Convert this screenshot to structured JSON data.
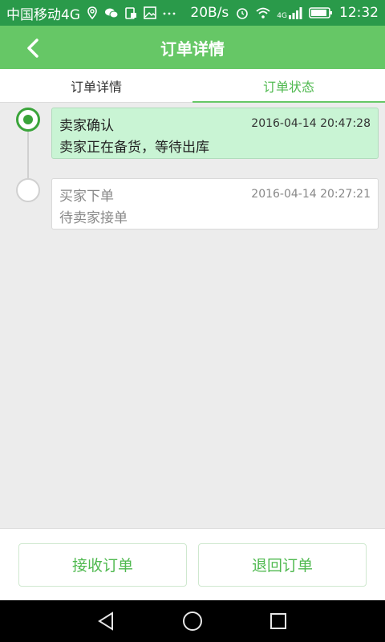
{
  "status_bar": {
    "carrier": "中国移动4G",
    "speed": "20B/s",
    "network": "4G",
    "time": "12:32"
  },
  "app_bar": {
    "title": "订单详情"
  },
  "tabs": [
    {
      "label": "订单详情",
      "active": false
    },
    {
      "label": "订单状态",
      "active": true
    }
  ],
  "timeline": [
    {
      "title": "卖家确认",
      "time": "2016-04-14 20:47:28",
      "desc": "卖家正在备货，等待出库",
      "active": true
    },
    {
      "title": "买家下单",
      "time": "2016-04-14 20:27:21",
      "desc": "待卖家接单",
      "active": false
    }
  ],
  "actions": {
    "accept_label": "接收订单",
    "return_label": "退回订单"
  },
  "colors": {
    "primary": "#66c766",
    "accent_text": "#4fb94f",
    "active_card": "#c9f4d4",
    "status_bar": "#2a9a4a"
  }
}
